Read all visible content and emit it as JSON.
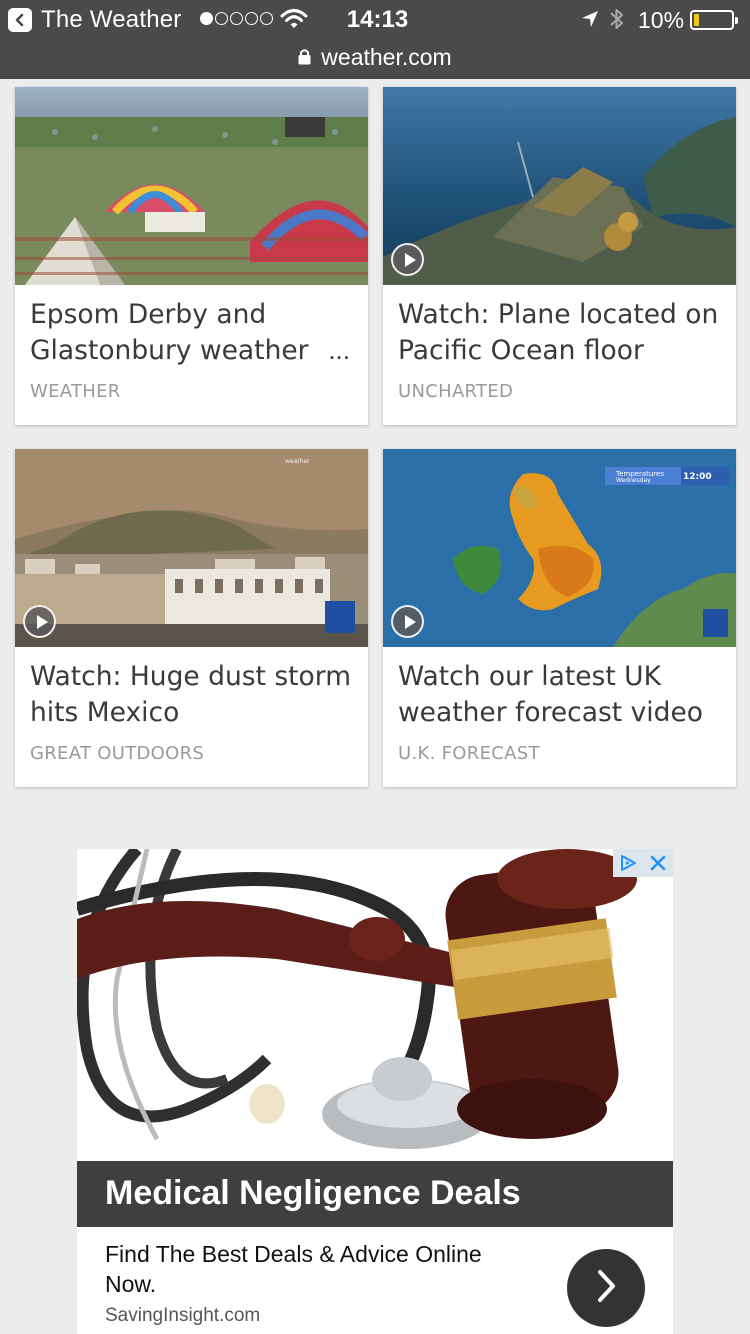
{
  "status_bar": {
    "back_app_name": "The Weather",
    "time": "14:13",
    "battery_percent": "10%",
    "signal_bars_filled": 1,
    "signal_bars_total": 5
  },
  "url_bar": {
    "domain": "weather.com"
  },
  "cards": [
    {
      "title": "Epsom Derby and Glastonbury weather",
      "category": "WEATHER",
      "has_play": false,
      "truncated": true
    },
    {
      "title": "Watch: Plane located on Pacific Ocean floor",
      "category": "UNCHARTED",
      "has_play": true
    },
    {
      "title": "Watch: Huge dust storm hits Mexico",
      "category": "GREAT OUTDOORS",
      "has_play": true
    },
    {
      "title": "Watch our latest UK weather forecast video",
      "category": "U.K. FORECAST",
      "has_play": true
    }
  ],
  "ellipsis": "...",
  "ad": {
    "headline": "Medical Negligence Deals",
    "description": "Find The Best Deals & Advice Online Now.",
    "domain": "SavingInsight.com"
  },
  "colors": {
    "topbar_bg": "#4a4a4a",
    "page_bg": "#ececec",
    "battery_fill": "#f5c518",
    "adchoices": "#1e90ff"
  }
}
